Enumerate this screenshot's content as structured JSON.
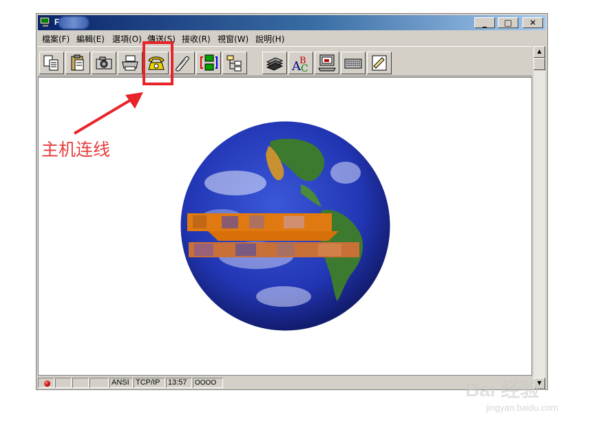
{
  "window": {
    "title": "F",
    "buttons": {
      "minimize": "_",
      "maximize": "□",
      "close": "✕"
    }
  },
  "menu": [
    {
      "label": "檔案(F)"
    },
    {
      "label": "編輯(E)"
    },
    {
      "label": "選項(O)"
    },
    {
      "label": "傳送(S)"
    },
    {
      "label": "接收(R)"
    },
    {
      "label": "視窗(W)"
    },
    {
      "label": "說明(H)"
    }
  ],
  "toolbar": {
    "buttons": [
      {
        "icon": "copy-icon"
      },
      {
        "icon": "paste-icon"
      },
      {
        "icon": "camera-icon"
      },
      {
        "icon": "printer-icon"
      },
      {
        "icon": "phone-icon"
      },
      {
        "icon": "hangup-icon"
      },
      {
        "icon": "transfer-icon"
      },
      {
        "icon": "tree-icon"
      },
      {
        "icon": "books-icon"
      },
      {
        "icon": "font-icon"
      },
      {
        "icon": "computer-icon"
      },
      {
        "icon": "keyboard-icon"
      },
      {
        "icon": "notepad-icon"
      }
    ]
  },
  "status": {
    "encoding": "ANSI",
    "protocol": "TCP/IP",
    "time": "13:57",
    "indicator": "OOOO"
  },
  "annotation": {
    "text": "主机连线",
    "color": "#e83c3c"
  },
  "watermark": {
    "brand": "Bai 经验",
    "url": "jingyan.baidu.com"
  }
}
